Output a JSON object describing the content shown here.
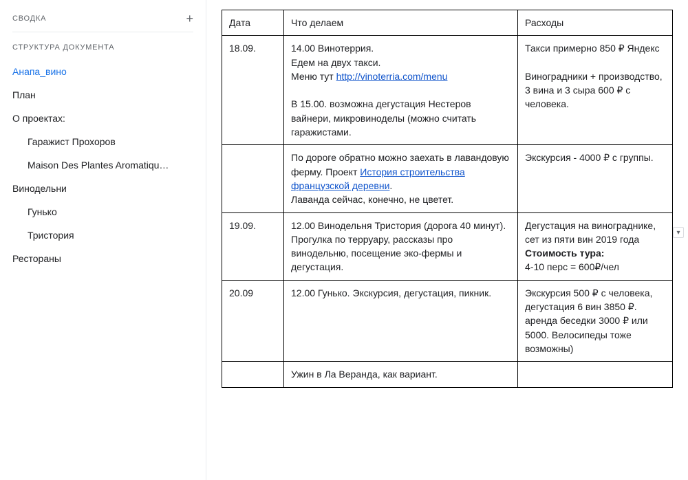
{
  "sidebar": {
    "summary_label": "СВОДКА",
    "structure_label": "СТРУКТУРА ДОКУМЕНТА",
    "items": [
      {
        "label": "Анапа_вино",
        "level": 0,
        "active": true
      },
      {
        "label": "План",
        "level": 0,
        "active": false
      },
      {
        "label": "О проектах:",
        "level": 0,
        "active": false
      },
      {
        "label": "Гаражист Прохоров",
        "level": 1,
        "active": false
      },
      {
        "label": "Maison Des Plantes Aromatiqu…",
        "level": 1,
        "active": false
      },
      {
        "label": "Винодельни",
        "level": 0,
        "active": false
      },
      {
        "label": "Гунько",
        "level": 1,
        "active": false
      },
      {
        "label": "Тристория",
        "level": 1,
        "active": false
      },
      {
        "label": "Рестораны",
        "level": 0,
        "active": false
      }
    ]
  },
  "table": {
    "headers": {
      "date": "Дата",
      "activity": "Что делаем",
      "expenses": "Расходы"
    },
    "rows": [
      {
        "date": "18.09.",
        "activity_pre": "14.00 Винотеррия.\nЕдем на двух такси.\nМеню тут ",
        "activity_link_text": "http://vinoterria.com/menu",
        "activity_post": "\n\nВ 15.00. возможна дегустация Нестеров вайнери, микровиноделы (можно считать гаражистами.",
        "expense": "Такси примерно 850 ₽ Яндекс\n\nВиноградники + производство, 3 вина и 3 сыра 600 ₽ с человека."
      },
      {
        "date": "",
        "activity_pre": "По дороге обратно можно заехать в лавандовую ферму. Проект ",
        "activity_link_text": "История строительства французской деревни",
        "activity_post": ".\nЛаванда сейчас, конечно, не цветет.",
        "expense": "Экскурсия - 4000 ₽ с группы."
      },
      {
        "date": "19.09.",
        "activity_pre": "12.00 Винодельня Тристория (дорога 40 минут).\nПрогулка по терруару, рассказы про винодельню, посещение эко-фермы и дегустация.",
        "activity_link_text": "",
        "activity_post": "",
        "expense_pre": "Дегустация на винограднике, сет из пяти вин 2019 года\n",
        "expense_bold": "Стоимость тура:",
        "expense_post": "\n4-10 перс = 600₽/чел"
      },
      {
        "date": "20.09",
        "activity_pre": "12.00 Гунько. Экскурсия, дегустация, пикник.",
        "activity_link_text": "",
        "activity_post": "",
        "expense": "Экскурсия 500 ₽ с человека, дегустация 6 вин 3850 ₽. аренда беседки 3000 ₽ или 5000. Велосипеды тоже возможны)"
      },
      {
        "date": "",
        "activity_pre": "Ужин в Ла Веранда, как вариант.",
        "activity_link_text": "",
        "activity_post": "",
        "expense": ""
      }
    ]
  }
}
